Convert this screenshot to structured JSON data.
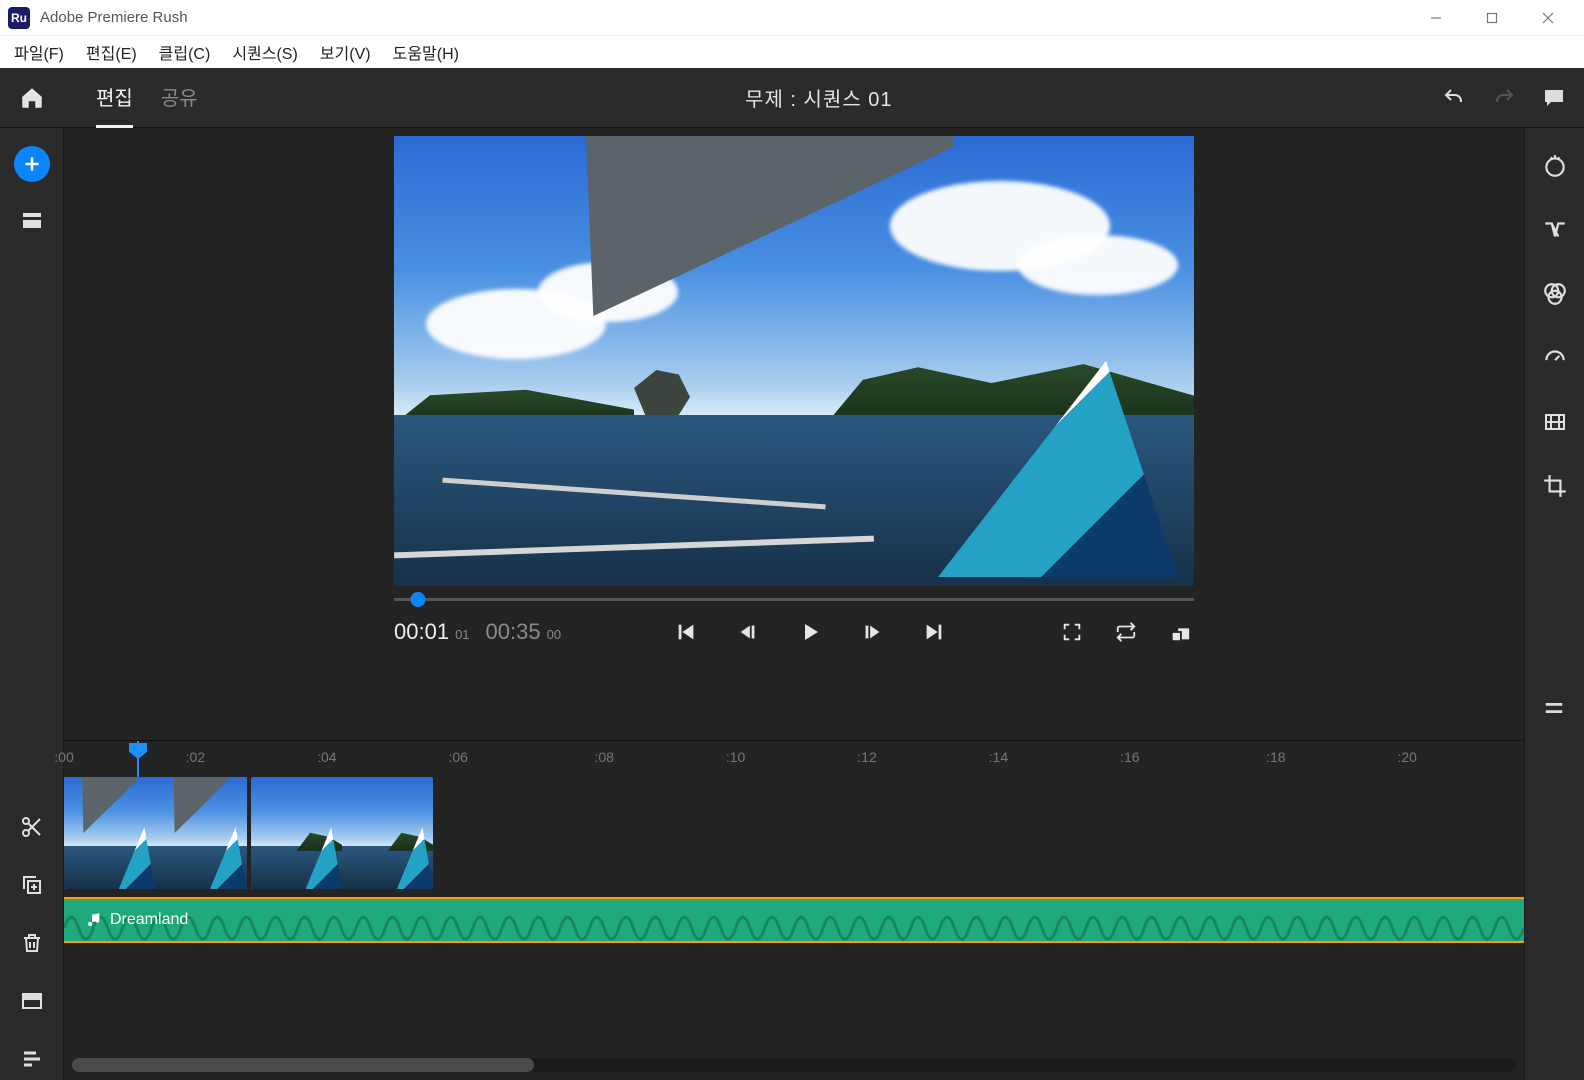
{
  "window": {
    "app_title": "Adobe Premiere Rush",
    "app_icon_text": "Ru"
  },
  "menubar": {
    "items": [
      "파일(F)",
      "편집(E)",
      "클립(C)",
      "시퀀스(S)",
      "보기(V)",
      "도움말(H)"
    ]
  },
  "topbar": {
    "tabs": {
      "edit": "편집",
      "share": "공유"
    },
    "title": "무제 : 시퀀스 01"
  },
  "transport": {
    "current_time": "00:01",
    "current_frames": "01",
    "duration": "00:35",
    "duration_frames": "00",
    "scrub_percent": 3
  },
  "ruler": {
    "ticks": [
      {
        "label": ":00",
        "pct": 0
      },
      {
        "label": ":02",
        "pct": 9
      },
      {
        "label": ":04",
        "pct": 18
      },
      {
        "label": ":06",
        "pct": 27
      },
      {
        "label": ":08",
        "pct": 37
      },
      {
        "label": ":10",
        "pct": 46
      },
      {
        "label": ":12",
        "pct": 55
      },
      {
        "label": ":14",
        "pct": 64
      },
      {
        "label": ":16",
        "pct": 73
      },
      {
        "label": ":18",
        "pct": 83
      },
      {
        "label": ":20",
        "pct": 92
      }
    ],
    "playhead_pct": 5
  },
  "clips": {
    "video": [
      {
        "selected": true,
        "left_pct": 0,
        "width_pct": 12.5
      },
      {
        "selected": false,
        "left_pct": 12.8,
        "width_pct": 12.5
      }
    ],
    "audio": {
      "name": "Dreamland",
      "left_pct": 0,
      "width_pct": 100
    }
  },
  "right_rail_tools": [
    "titles",
    "transitions",
    "color",
    "speed",
    "audio",
    "crop"
  ],
  "timeline_tools": [
    "scissors",
    "duplicate",
    "delete",
    "project",
    "tracks"
  ]
}
